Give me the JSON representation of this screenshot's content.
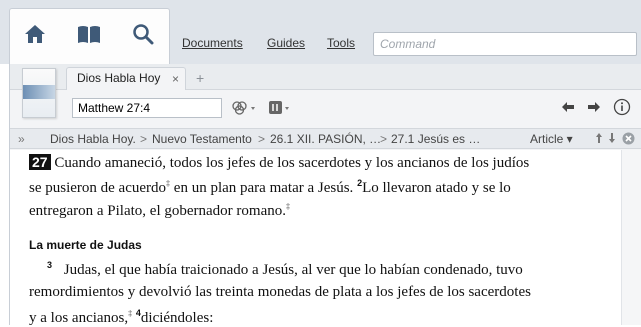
{
  "menu": {
    "documents": "Documents",
    "guides": "Guides",
    "tools": "Tools",
    "command_placeholder": "Command"
  },
  "tab": {
    "title": "Dios Habla Hoy",
    "close": "×",
    "add": "+"
  },
  "reference": {
    "value": "Matthew 27:4"
  },
  "breadcrumb": {
    "lead": "»",
    "items": [
      "Dios Habla Hoy.",
      "Nuevo Testamento",
      "26.1 XII. PASIÓN, …",
      "27.1 Jesús es …"
    ],
    "seps": [
      ">",
      ">",
      ">"
    ],
    "mode": "Article ▾"
  },
  "content": {
    "chapter": "27",
    "line1": "Cuando amaneció, todos los jefes de los sacerdotes y los ancianos de los judíos",
    "line2a": "se pusieron de acuerdo",
    "line2b": " en un plan para matar a Jesús. ",
    "v2": "2",
    "line2c": "Lo llevaron atado y se lo",
    "line3a": "entregaron a Pilato, el gobernador romano.",
    "heading": "La muerte de Judas",
    "v3": "3",
    "line4": "Judas, el que había traicionado a Jesús, al ver que lo habían condenado, tuvo",
    "line5": "remordimientos y devolvió las treinta monedas de plata a los jefes de los sacerdotes",
    "line6a": "y a los ancianos,",
    "v4": "4",
    "line6b": "diciéndoles:",
    "note_marker": "‡"
  }
}
